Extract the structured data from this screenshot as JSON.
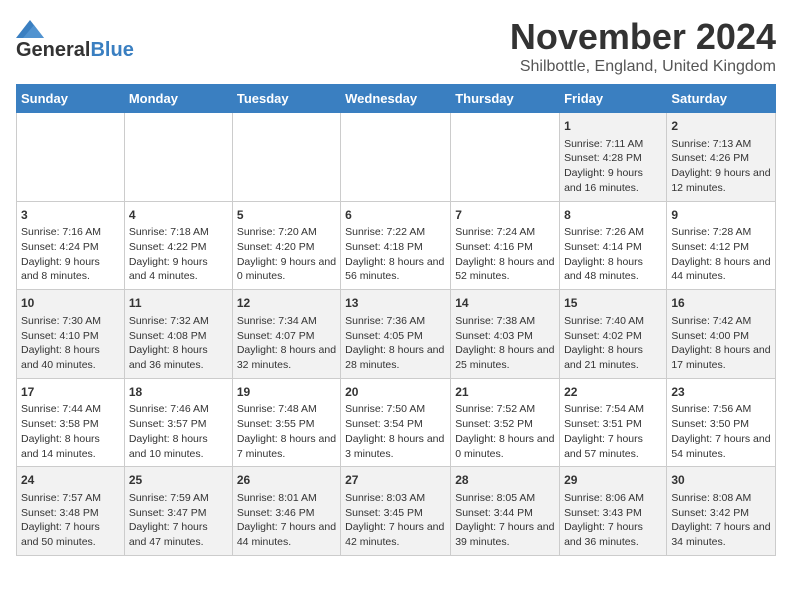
{
  "header": {
    "logo_line1": "General",
    "logo_line2": "Blue",
    "month": "November 2024",
    "location": "Shilbottle, England, United Kingdom"
  },
  "days_of_week": [
    "Sunday",
    "Monday",
    "Tuesday",
    "Wednesday",
    "Thursday",
    "Friday",
    "Saturday"
  ],
  "weeks": [
    [
      {
        "day": "",
        "info": ""
      },
      {
        "day": "",
        "info": ""
      },
      {
        "day": "",
        "info": ""
      },
      {
        "day": "",
        "info": ""
      },
      {
        "day": "",
        "info": ""
      },
      {
        "day": "1",
        "info": "Sunrise: 7:11 AM\nSunset: 4:28 PM\nDaylight: 9 hours and 16 minutes."
      },
      {
        "day": "2",
        "info": "Sunrise: 7:13 AM\nSunset: 4:26 PM\nDaylight: 9 hours and 12 minutes."
      }
    ],
    [
      {
        "day": "3",
        "info": "Sunrise: 7:16 AM\nSunset: 4:24 PM\nDaylight: 9 hours and 8 minutes."
      },
      {
        "day": "4",
        "info": "Sunrise: 7:18 AM\nSunset: 4:22 PM\nDaylight: 9 hours and 4 minutes."
      },
      {
        "day": "5",
        "info": "Sunrise: 7:20 AM\nSunset: 4:20 PM\nDaylight: 9 hours and 0 minutes."
      },
      {
        "day": "6",
        "info": "Sunrise: 7:22 AM\nSunset: 4:18 PM\nDaylight: 8 hours and 56 minutes."
      },
      {
        "day": "7",
        "info": "Sunrise: 7:24 AM\nSunset: 4:16 PM\nDaylight: 8 hours and 52 minutes."
      },
      {
        "day": "8",
        "info": "Sunrise: 7:26 AM\nSunset: 4:14 PM\nDaylight: 8 hours and 48 minutes."
      },
      {
        "day": "9",
        "info": "Sunrise: 7:28 AM\nSunset: 4:12 PM\nDaylight: 8 hours and 44 minutes."
      }
    ],
    [
      {
        "day": "10",
        "info": "Sunrise: 7:30 AM\nSunset: 4:10 PM\nDaylight: 8 hours and 40 minutes."
      },
      {
        "day": "11",
        "info": "Sunrise: 7:32 AM\nSunset: 4:08 PM\nDaylight: 8 hours and 36 minutes."
      },
      {
        "day": "12",
        "info": "Sunrise: 7:34 AM\nSunset: 4:07 PM\nDaylight: 8 hours and 32 minutes."
      },
      {
        "day": "13",
        "info": "Sunrise: 7:36 AM\nSunset: 4:05 PM\nDaylight: 8 hours and 28 minutes."
      },
      {
        "day": "14",
        "info": "Sunrise: 7:38 AM\nSunset: 4:03 PM\nDaylight: 8 hours and 25 minutes."
      },
      {
        "day": "15",
        "info": "Sunrise: 7:40 AM\nSunset: 4:02 PM\nDaylight: 8 hours and 21 minutes."
      },
      {
        "day": "16",
        "info": "Sunrise: 7:42 AM\nSunset: 4:00 PM\nDaylight: 8 hours and 17 minutes."
      }
    ],
    [
      {
        "day": "17",
        "info": "Sunrise: 7:44 AM\nSunset: 3:58 PM\nDaylight: 8 hours and 14 minutes."
      },
      {
        "day": "18",
        "info": "Sunrise: 7:46 AM\nSunset: 3:57 PM\nDaylight: 8 hours and 10 minutes."
      },
      {
        "day": "19",
        "info": "Sunrise: 7:48 AM\nSunset: 3:55 PM\nDaylight: 8 hours and 7 minutes."
      },
      {
        "day": "20",
        "info": "Sunrise: 7:50 AM\nSunset: 3:54 PM\nDaylight: 8 hours and 3 minutes."
      },
      {
        "day": "21",
        "info": "Sunrise: 7:52 AM\nSunset: 3:52 PM\nDaylight: 8 hours and 0 minutes."
      },
      {
        "day": "22",
        "info": "Sunrise: 7:54 AM\nSunset: 3:51 PM\nDaylight: 7 hours and 57 minutes."
      },
      {
        "day": "23",
        "info": "Sunrise: 7:56 AM\nSunset: 3:50 PM\nDaylight: 7 hours and 54 minutes."
      }
    ],
    [
      {
        "day": "24",
        "info": "Sunrise: 7:57 AM\nSunset: 3:48 PM\nDaylight: 7 hours and 50 minutes."
      },
      {
        "day": "25",
        "info": "Sunrise: 7:59 AM\nSunset: 3:47 PM\nDaylight: 7 hours and 47 minutes."
      },
      {
        "day": "26",
        "info": "Sunrise: 8:01 AM\nSunset: 3:46 PM\nDaylight: 7 hours and 44 minutes."
      },
      {
        "day": "27",
        "info": "Sunrise: 8:03 AM\nSunset: 3:45 PM\nDaylight: 7 hours and 42 minutes."
      },
      {
        "day": "28",
        "info": "Sunrise: 8:05 AM\nSunset: 3:44 PM\nDaylight: 7 hours and 39 minutes."
      },
      {
        "day": "29",
        "info": "Sunrise: 8:06 AM\nSunset: 3:43 PM\nDaylight: 7 hours and 36 minutes."
      },
      {
        "day": "30",
        "info": "Sunrise: 8:08 AM\nSunset: 3:42 PM\nDaylight: 7 hours and 34 minutes."
      }
    ]
  ]
}
